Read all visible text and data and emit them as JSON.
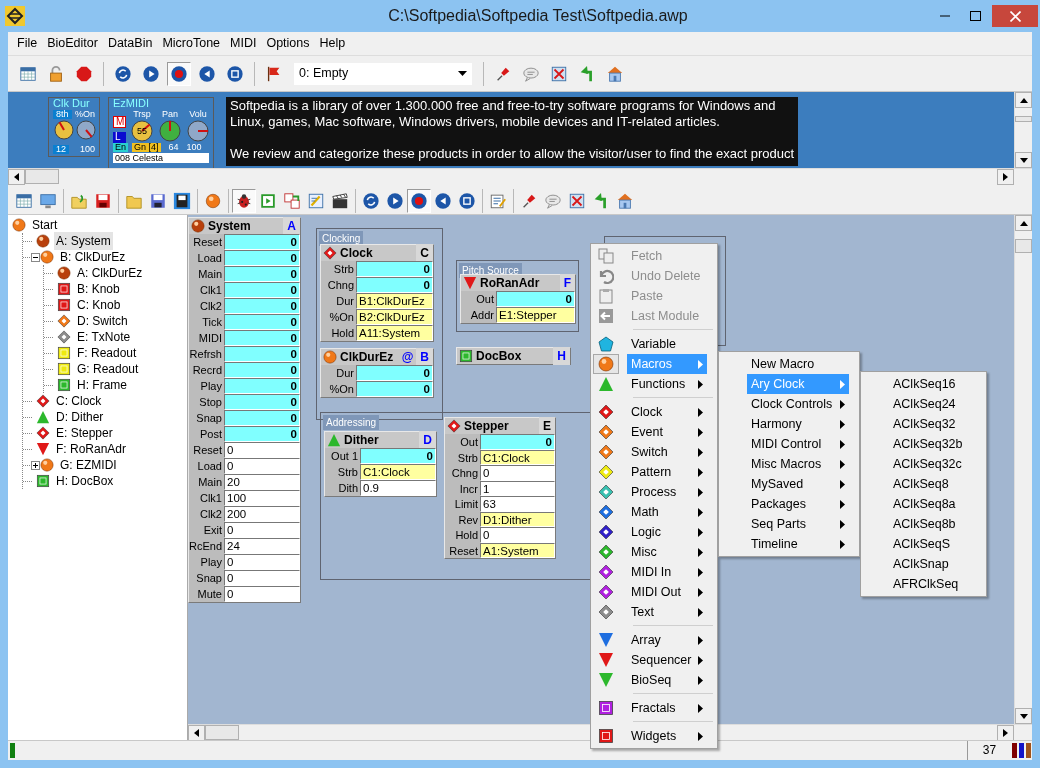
{
  "window": {
    "title": "C:\\Softpedia\\Softpedia Test\\Softpedia.awp"
  },
  "menu": [
    "File",
    "BioEditor",
    "DataBin",
    "MicroTone",
    "MIDI",
    "Options",
    "Help"
  ],
  "toolbar": [
    {
      "kind": "grid",
      "pressed": false
    },
    {
      "kind": "lock",
      "pressed": false
    },
    {
      "kind": "stop",
      "pressed": false
    },
    {
      "kind": "separator"
    },
    {
      "kind": "refresh",
      "pressed": false
    },
    {
      "kind": "play",
      "pressed": false
    },
    {
      "kind": "record",
      "pressed": true
    },
    {
      "kind": "rewind",
      "pressed": false
    },
    {
      "kind": "save",
      "pressed": false
    },
    {
      "kind": "separator"
    },
    {
      "kind": "flag",
      "pressed": false
    },
    {
      "kind": "preset"
    },
    {
      "kind": "separator"
    },
    {
      "kind": "pin",
      "pressed": false
    },
    {
      "kind": "bubble",
      "pressed": false
    },
    {
      "kind": "delete",
      "pressed": false
    },
    {
      "kind": "forward",
      "pressed": false
    },
    {
      "kind": "home",
      "pressed": false
    }
  ],
  "preset": {
    "value": "0: Empty"
  },
  "panel": {
    "clk_dur": {
      "title": "Clk Dur",
      "left_label": "8th",
      "right_label": "%On",
      "left_value": "12",
      "right_value": "100"
    },
    "ezmidi": {
      "title": "EzMIDI",
      "m_button": "M",
      "l_button": "L",
      "knobs": [
        {
          "label": "Trsp",
          "value": "55"
        },
        {
          "label": "Pan",
          "value": "64"
        },
        {
          "label": "Volu",
          "value": "100"
        }
      ],
      "en_button": "En",
      "gn_button": "Gn [4]",
      "instrument": "008 Celesta"
    },
    "doc_text": [
      [
        "Softpedia is a library of over 1.300.000 free and free-to-try software programs for Windows and",
        "Linux, games, Mac software, Windows drivers, mobile devices and IT-related articles."
      ],
      [
        "We review and categorize these products in order to allow the visitor/user to find the exact product"
      ]
    ]
  },
  "toolbar2": [
    {
      "kind": "grid",
      "pressed": false
    },
    {
      "kind": "monitor",
      "pressed": false
    },
    {
      "kind": "separator"
    },
    {
      "kind": "reopen",
      "pressed": false
    },
    {
      "kind": "savered",
      "pressed": false
    },
    {
      "kind": "separator"
    },
    {
      "kind": "folder",
      "pressed": false
    },
    {
      "kind": "disk",
      "pressed": false
    },
    {
      "kind": "saveas",
      "pressed": false
    },
    {
      "kind": "separator"
    },
    {
      "kind": "macro",
      "pressed": false
    },
    {
      "kind": "separator"
    },
    {
      "kind": "bug",
      "pressed": true
    },
    {
      "kind": "run",
      "pressed": false
    },
    {
      "kind": "import",
      "pressed": false
    },
    {
      "kind": "edit",
      "pressed": false
    },
    {
      "kind": "clapper",
      "pressed": false
    },
    {
      "kind": "separator"
    },
    {
      "kind": "refresh",
      "pressed": false
    },
    {
      "kind": "play",
      "pressed": false
    },
    {
      "kind": "record",
      "pressed": true
    },
    {
      "kind": "rewind",
      "pressed": false
    },
    {
      "kind": "save",
      "pressed": false
    },
    {
      "kind": "separator"
    },
    {
      "kind": "notes",
      "pressed": false
    },
    {
      "kind": "separator"
    },
    {
      "kind": "pin",
      "pressed": false
    },
    {
      "kind": "bubble",
      "pressed": false
    },
    {
      "kind": "delete",
      "pressed": false
    },
    {
      "kind": "forward",
      "pressed": false
    },
    {
      "kind": "home",
      "pressed": false
    }
  ],
  "tree": [
    {
      "label": "Start",
      "kind": "macro",
      "selected": false,
      "children": [
        {
          "label": "A: System",
          "kind": "core",
          "selected": true
        },
        {
          "label": "B: ClkDurEz",
          "kind": "macro",
          "selected": false,
          "expanded": true,
          "children": [
            {
              "label": "A: ClkDurEz",
              "kind": "core",
              "selected": false
            },
            {
              "label": "B: Knob",
              "kind": "knob",
              "selected": false
            },
            {
              "label": "C: Knob",
              "kind": "knob",
              "selected": false
            },
            {
              "label": "D: Switch",
              "kind": "switch",
              "selected": false
            },
            {
              "label": "E: TxNote",
              "kind": "txnote",
              "selected": false
            },
            {
              "label": "F: Readout",
              "kind": "readout",
              "selected": false
            },
            {
              "label": "G: Readout",
              "kind": "readout",
              "selected": false
            },
            {
              "label": "H: Frame",
              "kind": "frame",
              "selected": false
            }
          ]
        },
        {
          "label": "C: Clock",
          "kind": "clock",
          "selected": false
        },
        {
          "label": "D: Dither",
          "kind": "dither",
          "selected": false
        },
        {
          "label": "E: Stepper",
          "kind": "stepper",
          "selected": false
        },
        {
          "label": "F: RoRanAdr",
          "kind": "sequencer",
          "selected": false
        },
        {
          "label": "G: EZMIDI",
          "kind": "macro",
          "selected": false,
          "expanded": false
        },
        {
          "label": "H: DocBox",
          "kind": "docbox",
          "selected": false
        }
      ]
    }
  ],
  "groups": [
    {
      "title": "Clocking"
    },
    {
      "title": "Pitch Source"
    },
    {
      "title": "Addressing"
    }
  ],
  "modules": [
    {
      "title": "System",
      "kind": "core",
      "letter": "A",
      "color": "#0000ff",
      "rows": [
        {
          "label": "Reset",
          "value": "0",
          "kind": "out"
        },
        {
          "label": "Load",
          "value": "0",
          "kind": "out"
        },
        {
          "label": "Main",
          "value": "0",
          "kind": "out"
        },
        {
          "label": "Clk1",
          "value": "0",
          "kind": "out"
        },
        {
          "label": "Clk2",
          "value": "0",
          "kind": "out"
        },
        {
          "label": "Tick",
          "value": "0",
          "kind": "out"
        },
        {
          "label": "MIDI",
          "value": "0",
          "kind": "out"
        },
        {
          "label": "Refrsh",
          "value": "0",
          "kind": "out"
        },
        {
          "label": "Recrd",
          "value": "0",
          "kind": "out"
        },
        {
          "label": "Play",
          "value": "0",
          "kind": "out"
        },
        {
          "label": "Stop",
          "value": "0",
          "kind": "out"
        },
        {
          "label": "Snap",
          "value": "0",
          "kind": "out"
        },
        {
          "label": "Post",
          "value": "0",
          "kind": "out"
        },
        {
          "label": "Reset",
          "value": "0",
          "kind": "in"
        },
        {
          "label": "Load",
          "value": "0",
          "kind": "in"
        },
        {
          "label": "Main",
          "value": "20",
          "kind": "in"
        },
        {
          "label": "Clk1",
          "value": "100",
          "kind": "in"
        },
        {
          "label": "Clk2",
          "value": "200",
          "kind": "in"
        },
        {
          "label": "Exit",
          "value": "0",
          "kind": "in"
        },
        {
          "label": "RcEnd",
          "value": "24",
          "kind": "in"
        },
        {
          "label": "Play",
          "value": "0",
          "kind": "in"
        },
        {
          "label": "Snap",
          "value": "0",
          "kind": "in"
        },
        {
          "label": "Mute",
          "value": "0",
          "kind": "in"
        }
      ]
    },
    {
      "title": "Clock",
      "kind": "clock",
      "letter": "C",
      "color": "#000000",
      "rows": [
        {
          "label": "Strb",
          "value": "0",
          "kind": "out"
        },
        {
          "label": "Chng",
          "value": "0",
          "kind": "out"
        },
        {
          "label": "Dur",
          "value": "B1:ClkDurEz",
          "kind": "link"
        },
        {
          "label": "%On",
          "value": "B2:ClkDurEz",
          "kind": "link"
        },
        {
          "label": "Hold",
          "value": "A11:System",
          "kind": "link"
        }
      ]
    },
    {
      "title": "ClkDurEz",
      "kind": "macro",
      "tag": "@",
      "letter": "B",
      "color": "#0000ff",
      "rows": [
        {
          "label": "Dur",
          "value": "0",
          "kind": "out"
        },
        {
          "label": "%On",
          "value": "0",
          "kind": "out"
        }
      ]
    },
    {
      "title": "RoRanAdr",
      "kind": "sequencer",
      "letter": "F",
      "color": "#0000ff",
      "rows": [
        {
          "label": "Out",
          "value": "0",
          "kind": "out"
        },
        {
          "label": "Addr",
          "value": "E1:Stepper",
          "kind": "link"
        }
      ]
    },
    {
      "title": "DocBox",
      "kind": "docbox",
      "letter": "H",
      "color": "#0000ff"
    },
    {
      "title": "Dither",
      "kind": "dither",
      "letter": "D",
      "color": "#0000ff",
      "rows": [
        {
          "label": "Out 1",
          "value": "0",
          "kind": "out"
        },
        {
          "label": "Strb",
          "value": "C1:Clock",
          "kind": "link"
        },
        {
          "label": "Dith",
          "value": "0.9",
          "kind": "in"
        }
      ]
    },
    {
      "title": "Stepper",
      "kind": "stepper",
      "letter": "E",
      "color": "#000000",
      "rows": [
        {
          "label": "Out",
          "value": "0",
          "kind": "out"
        },
        {
          "label": "Strb",
          "value": "C1:Clock",
          "kind": "link"
        },
        {
          "label": "Chng",
          "value": "0",
          "kind": "in"
        },
        {
          "label": "Incr",
          "value": "1",
          "kind": "in"
        },
        {
          "label": "Limit",
          "value": "63",
          "kind": "in"
        },
        {
          "label": "Rev",
          "value": "D1:Dither",
          "kind": "link"
        },
        {
          "label": "Hold",
          "value": "0",
          "kind": "in"
        },
        {
          "label": "Reset",
          "value": "A1:System",
          "kind": "link"
        }
      ]
    }
  ],
  "context_menu": [
    {
      "kind": "fetch",
      "label": "Fetch",
      "disabled": true,
      "submenu": false,
      "selected": false
    },
    {
      "kind": "undo",
      "label": "Undo Delete",
      "disabled": true,
      "submenu": false,
      "selected": false
    },
    {
      "kind": "paste",
      "label": "Paste",
      "disabled": true,
      "submenu": false,
      "selected": false
    },
    {
      "kind": "back",
      "label": "Last Module",
      "disabled": true,
      "submenu": false,
      "selected": false
    },
    {
      "kind": "separator"
    },
    {
      "kind": "variable",
      "label": "Variable",
      "disabled": false,
      "submenu": false,
      "selected": false
    },
    {
      "kind": "macro",
      "label": "Macros",
      "disabled": false,
      "submenu": true,
      "selected": true
    },
    {
      "kind": "function",
      "label": "Functions",
      "disabled": false,
      "submenu": true,
      "selected": false
    },
    {
      "kind": "separator"
    },
    {
      "kind": "clock",
      "label": "Clock",
      "disabled": false,
      "submenu": true,
      "selected": false
    },
    {
      "kind": "event",
      "label": "Event",
      "disabled": false,
      "submenu": true,
      "selected": false
    },
    {
      "kind": "switch",
      "label": "Switch",
      "disabled": false,
      "submenu": true,
      "selected": false
    },
    {
      "kind": "pattern",
      "label": "Pattern",
      "disabled": false,
      "submenu": true,
      "selected": false
    },
    {
      "kind": "process",
      "label": "Process",
      "disabled": false,
      "submenu": true,
      "selected": false
    },
    {
      "kind": "math",
      "label": "Math",
      "disabled": false,
      "submenu": true,
      "selected": false
    },
    {
      "kind": "logic",
      "label": "Logic",
      "disabled": false,
      "submenu": true,
      "selected": false
    },
    {
      "kind": "misc",
      "label": "Misc",
      "disabled": false,
      "submenu": true,
      "selected": false
    },
    {
      "kind": "midiin",
      "label": "MIDI In",
      "disabled": false,
      "submenu": true,
      "selected": false
    },
    {
      "kind": "midiout",
      "label": "MIDI Out",
      "disabled": false,
      "submenu": true,
      "selected": false
    },
    {
      "kind": "text",
      "label": "Text",
      "disabled": false,
      "submenu": true,
      "selected": false
    },
    {
      "kind": "separator"
    },
    {
      "kind": "array",
      "label": "Array",
      "disabled": false,
      "submenu": true,
      "selected": false
    },
    {
      "kind": "sequencer",
      "label": "Sequencer",
      "disabled": false,
      "submenu": true,
      "selected": false
    },
    {
      "kind": "bioseq",
      "label": "BioSeq",
      "disabled": false,
      "submenu": true,
      "selected": false
    },
    {
      "kind": "separator"
    },
    {
      "kind": "fractal",
      "label": "Fractals",
      "disabled": false,
      "submenu": true,
      "selected": false
    },
    {
      "kind": "separator"
    },
    {
      "kind": "widget",
      "label": "Widgets",
      "disabled": false,
      "submenu": true,
      "selected": false
    }
  ],
  "macros_menu": [
    {
      "label": "New Macro",
      "submenu": false,
      "selected": false
    },
    {
      "label": "Ary Clock",
      "submenu": true,
      "selected": true
    },
    {
      "label": "Clock Controls",
      "submenu": true,
      "selected": false
    },
    {
      "label": "Harmony",
      "submenu": true,
      "selected": false
    },
    {
      "label": "MIDI Control",
      "submenu": true,
      "selected": false
    },
    {
      "label": "Misc Macros",
      "submenu": true,
      "selected": false
    },
    {
      "label": "MySaved",
      "submenu": true,
      "selected": false
    },
    {
      "label": "Packages",
      "submenu": true,
      "selected": false
    },
    {
      "label": "Seq Parts",
      "submenu": true,
      "selected": false
    },
    {
      "label": "Timeline",
      "submenu": true,
      "selected": false
    }
  ],
  "ary_clock_menu": [
    {
      "label": "AClkSeq16",
      "selected": false
    },
    {
      "label": "AClkSeq24",
      "selected": false
    },
    {
      "label": "AClkSeq32",
      "selected": false
    },
    {
      "label": "AClkSeq32b",
      "selected": false
    },
    {
      "label": "AClkSeq32c",
      "selected": false
    },
    {
      "label": "AClkSeq8",
      "selected": false
    },
    {
      "label": "AClkSeq8a",
      "selected": false
    },
    {
      "label": "AClkSeq8b",
      "selected": false
    },
    {
      "label": "AClkSeqS",
      "selected": false
    },
    {
      "label": "AClkSnap",
      "selected": false
    },
    {
      "label": "AFRClkSeq",
      "selected": false
    }
  ],
  "status_bar": {
    "count": "37",
    "indicators": [
      {
        "color": "#800000"
      },
      {
        "color": "#1414c8"
      },
      {
        "color": "#a0521a"
      }
    ]
  }
}
